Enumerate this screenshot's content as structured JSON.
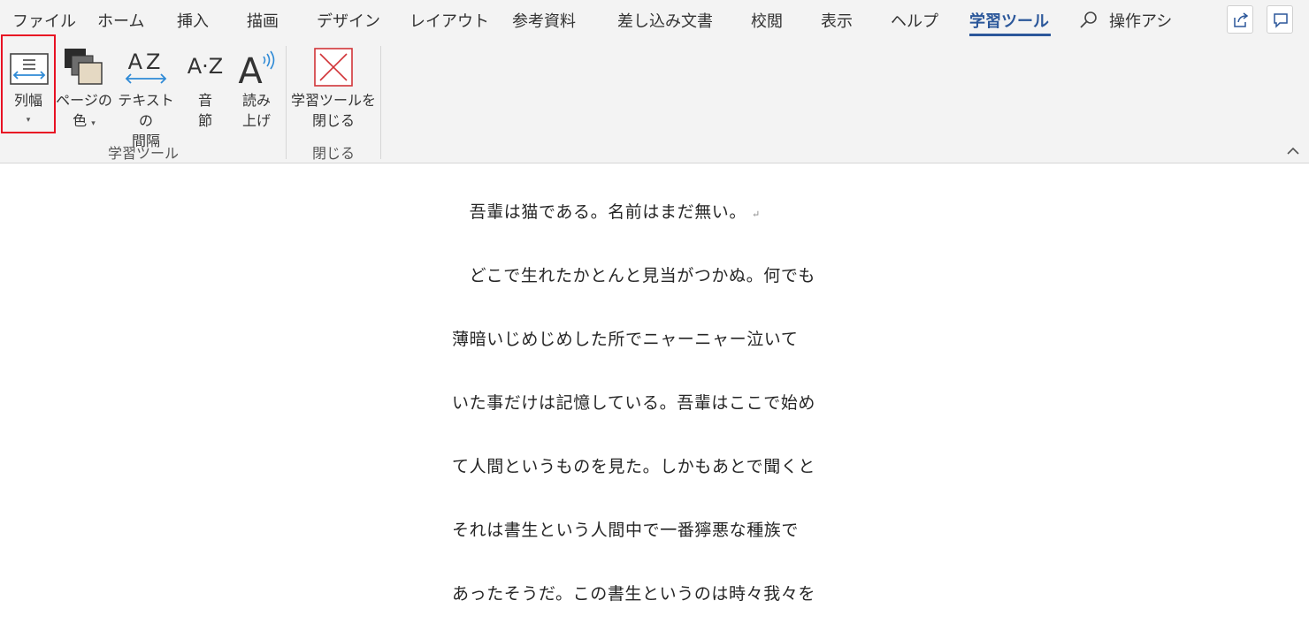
{
  "tabs": [
    {
      "label": "ファイル"
    },
    {
      "label": "ホーム"
    },
    {
      "label": "挿入"
    },
    {
      "label": "描画"
    },
    {
      "label": "デザイン"
    },
    {
      "label": "レイアウト"
    },
    {
      "label": "参考資料"
    },
    {
      "label": "差し込み文書"
    },
    {
      "label": "校閲"
    },
    {
      "label": "表示"
    },
    {
      "label": "ヘルプ"
    },
    {
      "label": "学習ツール"
    }
  ],
  "search": {
    "label": "操作アシ"
  },
  "ribbon": {
    "column_width": {
      "line1": "列幅",
      "arrow": "▾"
    },
    "page_color": {
      "line1": "ページの",
      "line2": "色",
      "arrow": "▾"
    },
    "text_spacing": {
      "line1": "テキストの",
      "line2": "間隔"
    },
    "syllables": {
      "line1": "音",
      "line2": "節"
    },
    "read_aloud": {
      "line1": "読み",
      "line2": "上げ"
    },
    "close_tools": {
      "line1": "学習ツールを",
      "line2": "閉じる"
    },
    "group_learning": "学習ツール",
    "group_close": "閉じる",
    "icon_text_az": "AZ",
    "icon_text_a_z": "A·Z",
    "icon_text_a": "A"
  },
  "document": {
    "paragraphs": [
      "　吾輩は猫である。名前はまだ無い。",
      "　どこで生れたかとんと見当がつかぬ。何でも",
      "薄暗いじめじめした所でニャーニャー泣いて",
      "いた事だけは記憶している。吾輩はここで始め",
      "て人間というものを見た。しかもあとで聞くと",
      "それは書生という人間中で一番獰悪な種族で",
      "あったそうだ。この書生というのは時々我々を"
    ],
    "pilcrow": "↵"
  },
  "colors": {
    "accent": "#2b579a",
    "highlight": "#e81123",
    "close_icon": "#d13438"
  }
}
